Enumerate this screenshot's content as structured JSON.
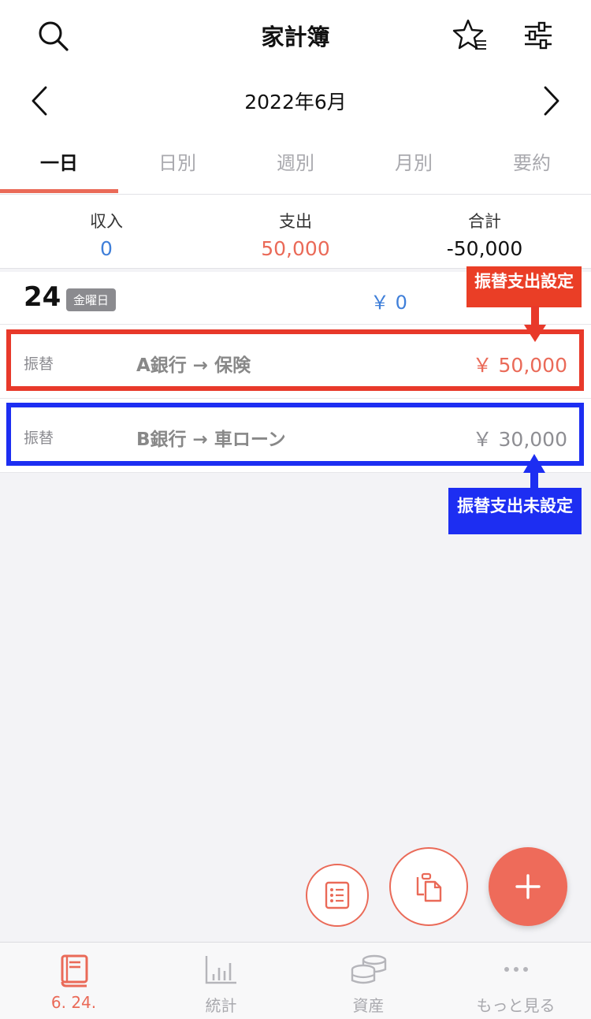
{
  "header": {
    "title": "家計簿"
  },
  "month_nav": {
    "month": "2022年6月"
  },
  "tabs": [
    {
      "label": "一日",
      "active": true
    },
    {
      "label": "日別"
    },
    {
      "label": "週別"
    },
    {
      "label": "月別"
    },
    {
      "label": "要約"
    }
  ],
  "summary": {
    "income_label": "収入",
    "income_value": "0",
    "expense_label": "支出",
    "expense_value": "50,000",
    "total_label": "合計",
    "total_value": "-50,000"
  },
  "day": {
    "number": "24",
    "weekday": "金曜日",
    "income": "￥ 0"
  },
  "transactions": [
    {
      "category": "振替",
      "description": "A銀行 → 保険",
      "amount": "￥ 50,000",
      "color": "#ea6a58"
    },
    {
      "category": "振替",
      "description": "B銀行 → 車ローン",
      "amount": "￥ 30,000",
      "color": "#8e8e93"
    }
  ],
  "annotations": {
    "red_label": "振替支出設定",
    "blue_label": "振替支出未設定"
  },
  "bottom_nav": [
    {
      "label": "6. 24.",
      "active": true,
      "icon": "book-icon"
    },
    {
      "label": "統計",
      "icon": "stats-icon"
    },
    {
      "label": "資産",
      "icon": "coins-icon"
    },
    {
      "label": "もっと見る",
      "icon": "more-icon"
    }
  ],
  "colors": {
    "accent": "#ea6a58",
    "income": "#3f7fd9",
    "annotation_red": "#e8392a",
    "annotation_blue": "#1d2ef2"
  }
}
